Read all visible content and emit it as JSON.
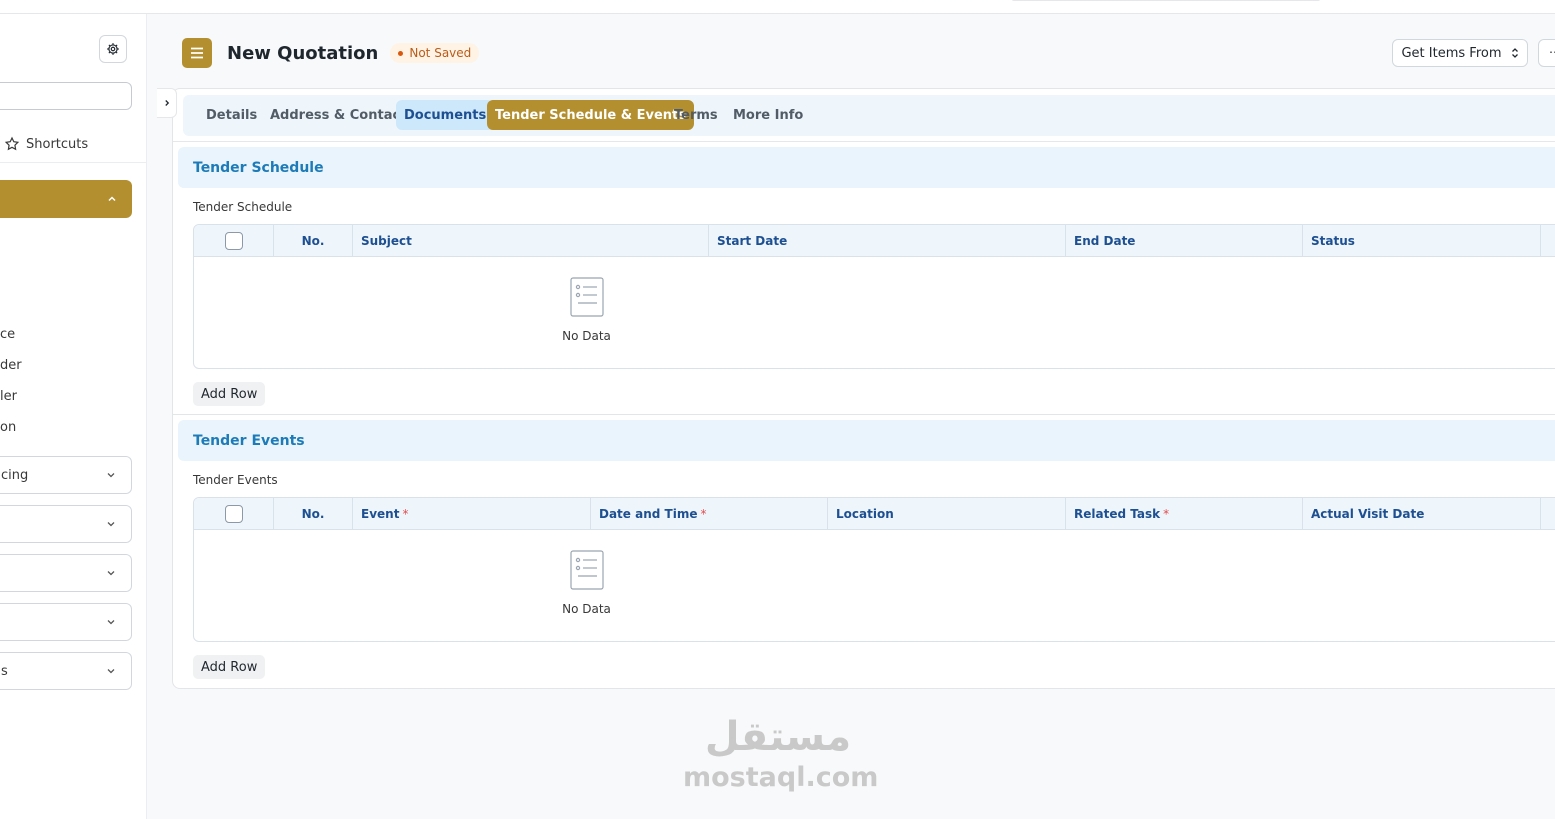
{
  "header": {
    "title": "New Quotation",
    "status": "Not Saved",
    "get_items_label": "Get Items From",
    "more_label": "⋯"
  },
  "sidebar": {
    "shortcuts_label": "Shortcuts",
    "items": [
      "ce",
      "der",
      "ler",
      "on"
    ],
    "groups": [
      "cing",
      "",
      "",
      "",
      "s"
    ]
  },
  "tabs": [
    {
      "label": "Details"
    },
    {
      "label": "Address & Contact"
    },
    {
      "label": "Documents"
    },
    {
      "label": "Tender Schedule & Events"
    },
    {
      "label": "Terms"
    },
    {
      "label": "More Info"
    }
  ],
  "tender_schedule": {
    "section_title": "Tender Schedule",
    "field_label": "Tender Schedule",
    "columns": [
      "No.",
      "Subject",
      "Start Date",
      "End Date",
      "Status"
    ],
    "empty_text": "No Data",
    "add_row_label": "Add Row"
  },
  "tender_events": {
    "section_title": "Tender Events",
    "field_label": "Tender Events",
    "columns": [
      "No.",
      "Event",
      "Date and Time",
      "Location",
      "Related Task",
      "Actual Visit Date"
    ],
    "required_mark": "*",
    "empty_text": "No Data",
    "add_row_label": "Add Row"
  },
  "watermark": {
    "arabic": "مستقل",
    "latin": "mostaql.com"
  },
  "colors": {
    "accent": "#b38f2f",
    "section_title": "#1d7bb8",
    "tab_bar": "#eef6fc",
    "required": "#e24c4c"
  }
}
